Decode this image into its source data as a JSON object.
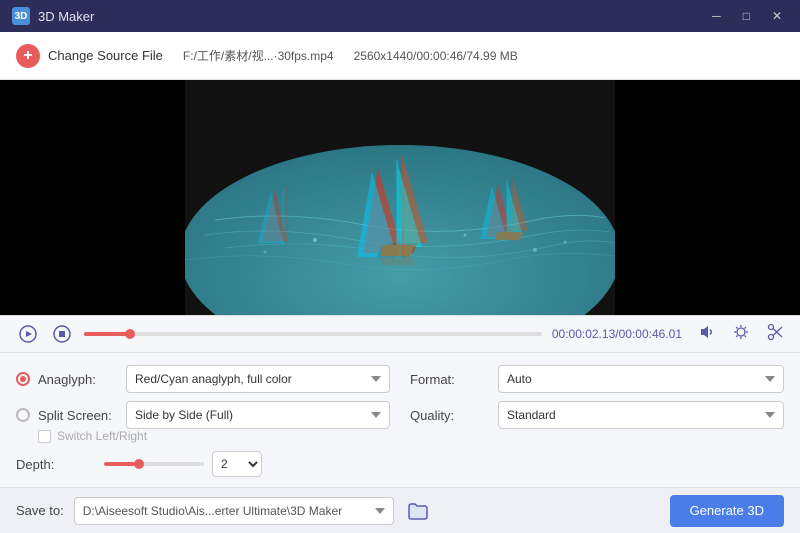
{
  "titlebar": {
    "icon": "3D",
    "title": "3D Maker",
    "min_btn": "─",
    "max_btn": "□",
    "close_btn": "✕"
  },
  "toolbar": {
    "change_label": "Change Source File",
    "file_path": "F:/工作/素材/视...·30fps.mp4",
    "file_meta": "2560x1440/00:00:46/74.99 MB"
  },
  "transport": {
    "time_current": "00:00:02.13",
    "time_total": "00:00:46.01"
  },
  "controls": {
    "anaglyph_label": "Anaglyph:",
    "anaglyph_value": "Red/Cyan anaglyph, full color",
    "split_label": "Split Screen:",
    "split_value": "Side by Side (Full)",
    "switch_label": "Switch Left/Right",
    "depth_label": "Depth:",
    "depth_value": "2",
    "format_label": "Format:",
    "format_value": "Auto",
    "quality_label": "Quality:",
    "quality_value": "Standard"
  },
  "bottombar": {
    "save_label": "Save to:",
    "save_path": "D:\\Aiseesoft Studio\\Ais...erter Ultimate\\3D Maker",
    "generate_btn": "Generate 3D"
  },
  "icons": {
    "play": "▶",
    "stop": "⏹",
    "volume": "🔊",
    "settings": "⚙",
    "cut": "✂",
    "folder": "📁"
  }
}
